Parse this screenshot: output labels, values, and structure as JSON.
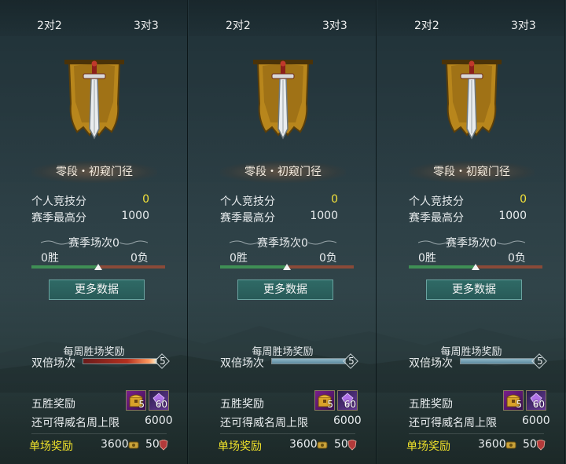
{
  "panels": [
    {
      "tabs": [
        "2对2",
        "3对3"
      ],
      "rank_title": "零段・初窥门径",
      "personal_score_label": "个人竞技分",
      "personal_score_value": "0",
      "season_high_label": "赛季最高分",
      "season_high_value": "1000",
      "season_matches": "赛季场次0",
      "wins": "0胜",
      "losses": "0负",
      "more_data_button": "更多数据",
      "weekly_reward_label": "每周胜场奖励",
      "double_matches_label": "双倍场次",
      "double_matches_value": "5",
      "five_win_label": "五胜奖励",
      "item_chest_count": "5",
      "item_gem_count": "60",
      "remaining_cap_label": "还可得威名周上限",
      "remaining_cap_value": "6000",
      "single_reward_label": "单场奖励",
      "single_reward_coin": "3600",
      "single_reward_badge": "50"
    },
    {
      "tabs": [
        "2对2",
        "3对3"
      ],
      "rank_title": "零段・初窥门径",
      "personal_score_label": "个人竞技分",
      "personal_score_value": "0",
      "season_high_label": "赛季最高分",
      "season_high_value": "1000",
      "season_matches": "赛季场次0",
      "wins": "0胜",
      "losses": "0负",
      "more_data_button": "更多数据",
      "weekly_reward_label": "每周胜场奖励",
      "double_matches_label": "双倍场次",
      "double_matches_value": "5",
      "five_win_label": "五胜奖励",
      "item_chest_count": "5",
      "item_gem_count": "60",
      "remaining_cap_label": "还可得威名周上限",
      "remaining_cap_value": "6000",
      "single_reward_label": "单场奖励",
      "single_reward_coin": "3600",
      "single_reward_badge": "50"
    },
    {
      "tabs": [
        "2对2",
        "3对3"
      ],
      "rank_title": "零段・初窥门径",
      "personal_score_label": "个人竞技分",
      "personal_score_value": "0",
      "season_high_label": "赛季最高分",
      "season_high_value": "1000",
      "season_matches": "赛季场次0",
      "wins": "0胜",
      "losses": "0负",
      "more_data_button": "更多数据",
      "weekly_reward_label": "每周胜场奖励",
      "double_matches_label": "双倍场次",
      "double_matches_value": "5",
      "five_win_label": "五胜奖励",
      "item_chest_count": "5",
      "item_gem_count": "60",
      "remaining_cap_label": "还可得威名周上限",
      "remaining_cap_value": "6000",
      "single_reward_label": "单场奖励",
      "single_reward_coin": "3600",
      "single_reward_badge": "50"
    }
  ],
  "progress": {
    "win_loss_split": 0.5,
    "double_matches_fill": 1.0
  },
  "icons": [
    "sword-banner-icon",
    "treasure-chest-icon",
    "purple-gem-icon",
    "coin-icon",
    "shield-badge-icon"
  ],
  "colors": {
    "score_highlight": "#f3e23a",
    "single_reward_label": "#f0e22a",
    "win_bar": "#3f8f55",
    "loss_bar": "#8a4a38",
    "button": "#2f6a66"
  }
}
